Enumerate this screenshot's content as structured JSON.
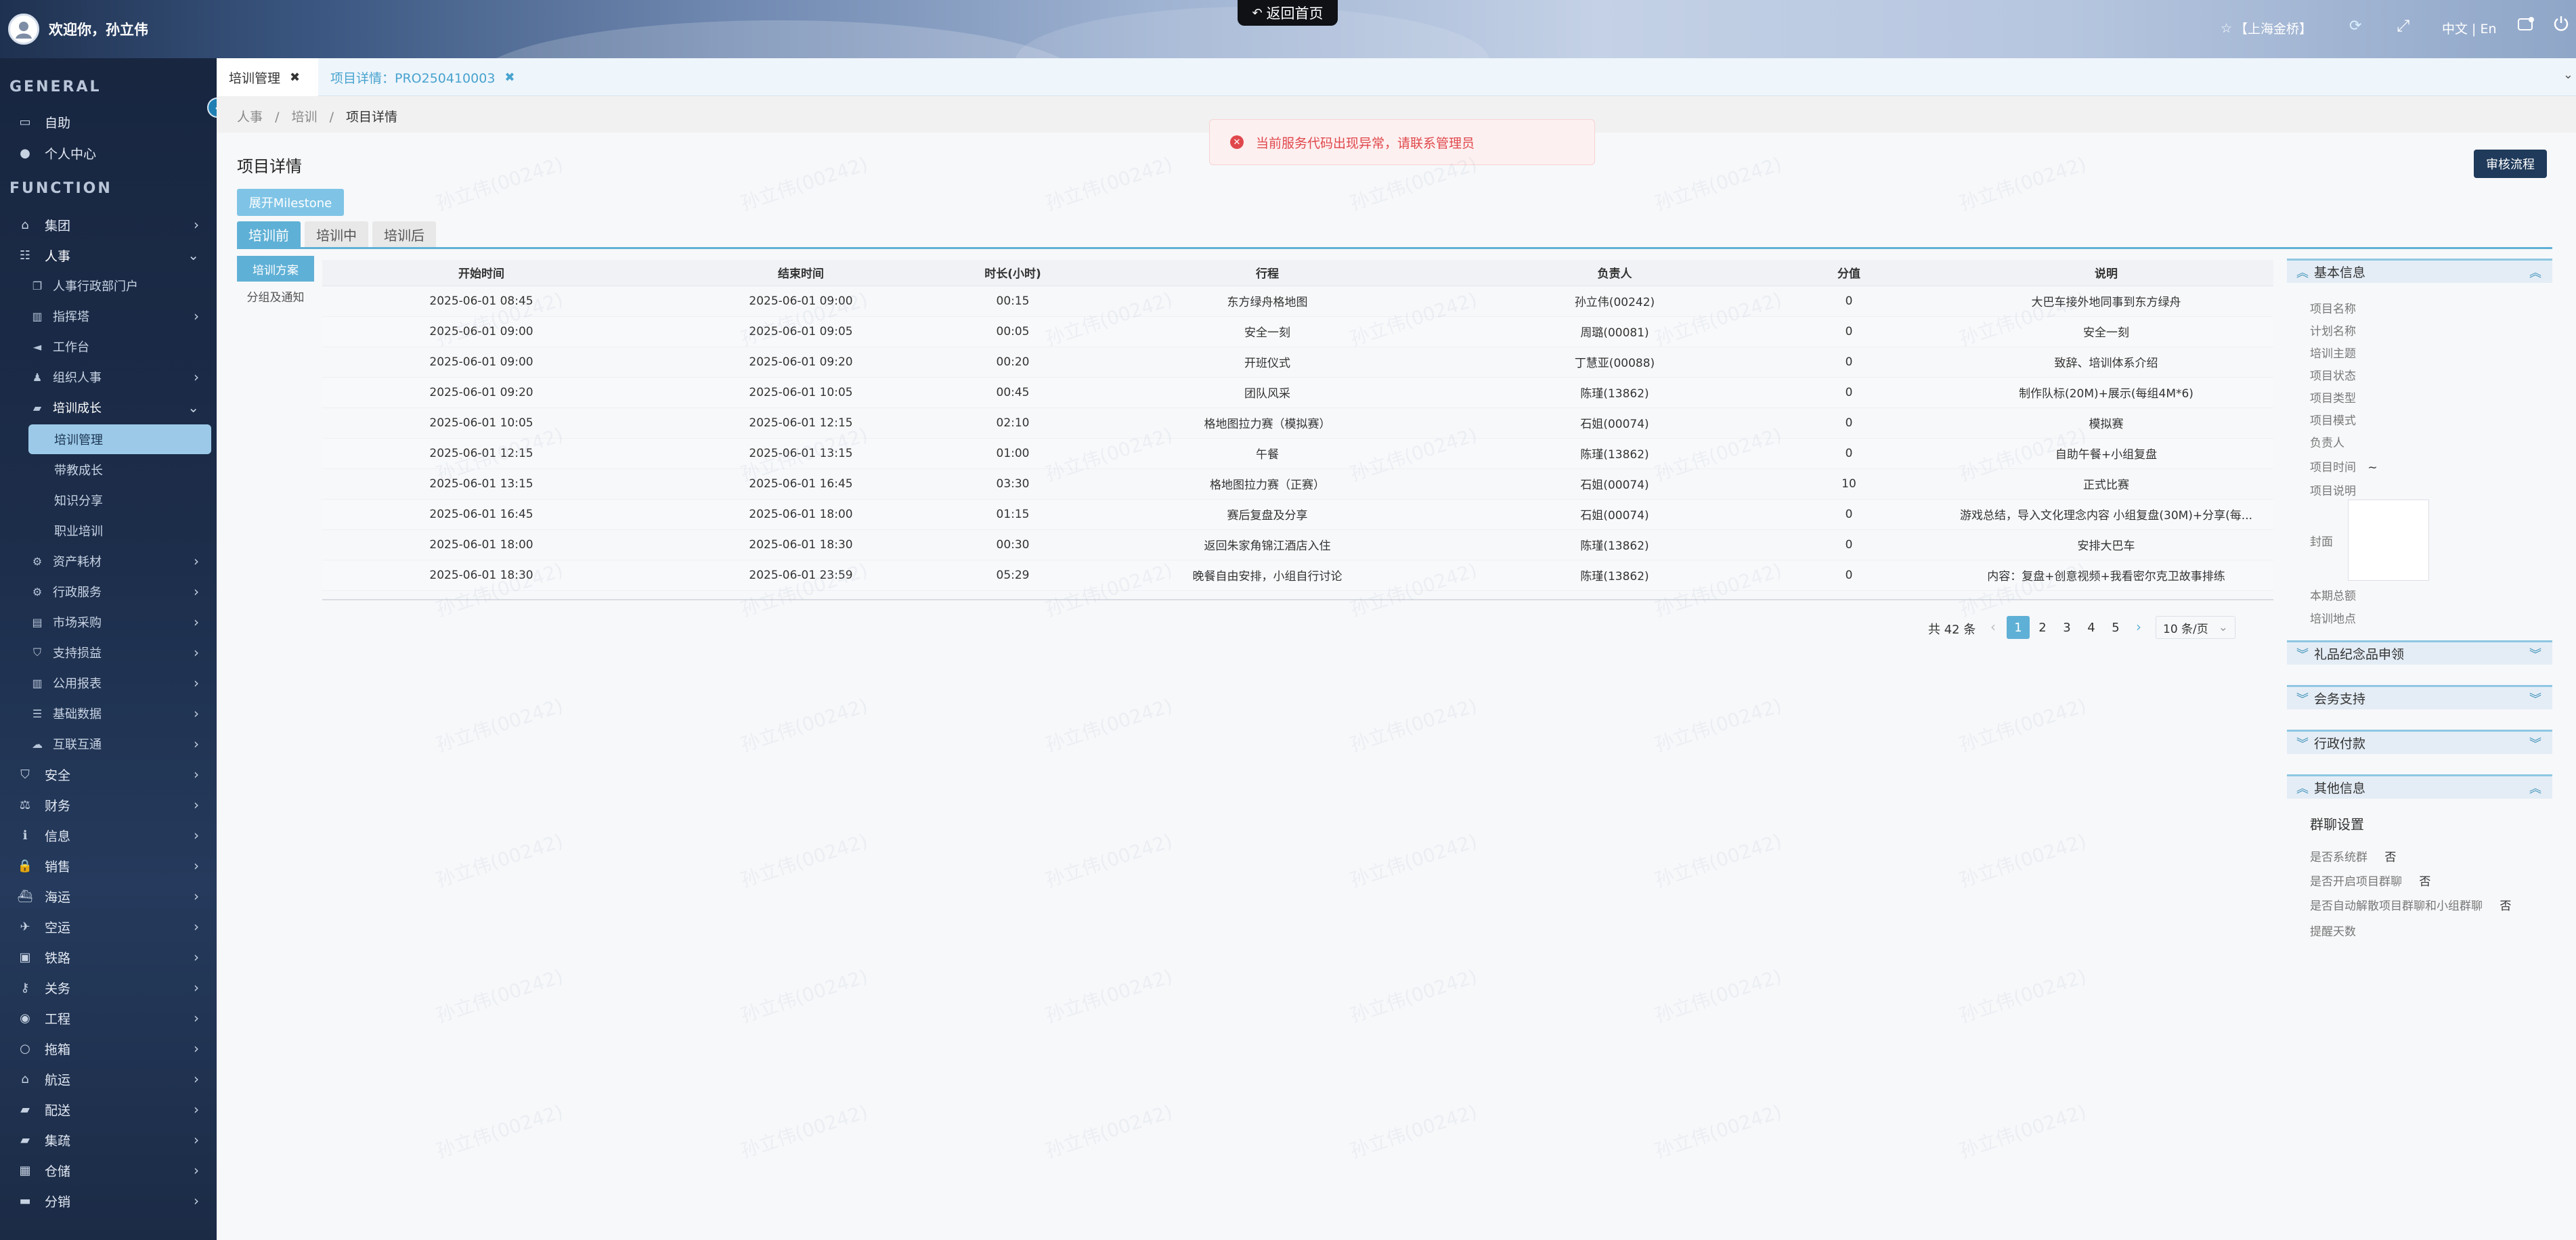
{
  "header": {
    "welcome": "欢迎你，孙立伟",
    "home_button": "返回首页",
    "location": "【上海金桥】",
    "language": "中文 | En"
  },
  "sidebar": {
    "general_label": "GENERAL",
    "function_label": "FUNCTION",
    "general_items": [
      {
        "label": "自助",
        "icon": "desktop-icon"
      },
      {
        "label": "个人中心",
        "icon": "user-icon"
      }
    ],
    "function_items": [
      {
        "label": "集团",
        "icon": "bank-icon"
      },
      {
        "label": "人事",
        "icon": "sitemap-icon"
      }
    ],
    "hr_items": [
      {
        "label": "人事行政部门户",
        "icon": "copy-icon",
        "chevron": false
      },
      {
        "label": "指挥塔",
        "icon": "bar-chart-icon",
        "chevron": true
      },
      {
        "label": "工作台",
        "icon": "bullhorn-icon",
        "chevron": false
      },
      {
        "label": "组织人事",
        "icon": "users-icon",
        "chevron": true
      },
      {
        "label": "培训成长",
        "icon": "book-icon",
        "chevron": true
      }
    ],
    "training_items": [
      "培训管理",
      "带教成长",
      "知识分享",
      "职业培训"
    ],
    "hr_more_items": [
      {
        "label": "资产耗材",
        "icon": "gear-icon"
      },
      {
        "label": "行政服务",
        "icon": "gear-icon"
      },
      {
        "label": "市场采购",
        "icon": "cart-icon"
      },
      {
        "label": "支持损益",
        "icon": "shield-icon"
      },
      {
        "label": "公用报表",
        "icon": "chart-icon"
      },
      {
        "label": "基础数据",
        "icon": "database-icon"
      },
      {
        "label": "互联互通",
        "icon": "cloud-icon"
      }
    ],
    "bottom_items": [
      {
        "label": "安全",
        "icon": "shield-icon"
      },
      {
        "label": "财务",
        "icon": "balance-icon"
      },
      {
        "label": "信息",
        "icon": "info-icon"
      },
      {
        "label": "销售",
        "icon": "lock-icon"
      },
      {
        "label": "海运",
        "icon": "ship-icon"
      },
      {
        "label": "空运",
        "icon": "plane-icon"
      },
      {
        "label": "铁路",
        "icon": "train-icon"
      },
      {
        "label": "关务",
        "icon": "key-icon"
      },
      {
        "label": "工程",
        "icon": "globe-icon"
      },
      {
        "label": "拖箱",
        "icon": "circle-icon"
      },
      {
        "label": "航运",
        "icon": "bank-icon"
      },
      {
        "label": "配送",
        "icon": "truck-icon"
      },
      {
        "label": "集疏",
        "icon": "truck-icon"
      },
      {
        "label": "仓储",
        "icon": "building-icon"
      },
      {
        "label": "分销",
        "icon": "card-icon"
      }
    ]
  },
  "tabs": [
    {
      "label": "培训管理",
      "active": true
    },
    {
      "label": "项目详情：PRO250410003",
      "active": false
    }
  ],
  "breadcrumb": [
    "人事",
    "培训",
    "项目详情"
  ],
  "page": {
    "title": "项目详情",
    "review_button": "审核流程",
    "milestone_button": "展开Milestone",
    "phase_tabs": [
      "培训前",
      "培训中",
      "培训后"
    ],
    "left_menu": [
      "培训方案",
      "分组及通知"
    ]
  },
  "error_toast": "当前服务代码出现异常，请联系管理员",
  "table": {
    "columns": [
      "开始时间",
      "结束时间",
      "时长(小时)",
      "行程",
      "负责人",
      "分值",
      "说明"
    ],
    "rows": [
      [
        "2025-06-01 08:45",
        "2025-06-01 09:00",
        "00:15",
        "东方绿舟格地图",
        "孙立伟(00242)",
        "0",
        "大巴车接外地同事到东方绿舟"
      ],
      [
        "2025-06-01 09:00",
        "2025-06-01 09:05",
        "00:05",
        "安全一刻",
        "周璐(00081)",
        "0",
        "安全一刻"
      ],
      [
        "2025-06-01 09:00",
        "2025-06-01 09:20",
        "00:20",
        "开班仪式",
        "丁慧亚(00088)",
        "0",
        "致辞、培训体系介绍"
      ],
      [
        "2025-06-01 09:20",
        "2025-06-01 10:05",
        "00:45",
        "团队风采",
        "陈瑾(13862)",
        "0",
        "制作队标(20M)+展示(每组4M*6)"
      ],
      [
        "2025-06-01 10:05",
        "2025-06-01 12:15",
        "02:10",
        "格地图拉力赛（模拟赛）",
        "石姐(00074)",
        "0",
        "模拟赛"
      ],
      [
        "2025-06-01 12:15",
        "2025-06-01 13:15",
        "01:00",
        "午餐",
        "陈瑾(13862)",
        "0",
        "自助午餐+小组复盘"
      ],
      [
        "2025-06-01 13:15",
        "2025-06-01 16:45",
        "03:30",
        "格地图拉力赛（正赛）",
        "石姐(00074)",
        "10",
        "正式比赛"
      ],
      [
        "2025-06-01 16:45",
        "2025-06-01 18:00",
        "01:15",
        "赛后复盘及分享",
        "石姐(00074)",
        "0",
        "游戏总结，导入文化理念内容 小组复盘(30M)+分享(每..."
      ],
      [
        "2025-06-01 18:00",
        "2025-06-01 18:30",
        "00:30",
        "返回朱家角锦江酒店入住",
        "陈瑾(13862)",
        "0",
        "安排大巴车"
      ],
      [
        "2025-06-01 18:30",
        "2025-06-01 23:59",
        "05:29",
        "晚餐自由安排，小组自行讨论",
        "陈瑾(13862)",
        "0",
        "内容：复盘+创意视频+我看密尔克卫故事排练"
      ]
    ]
  },
  "pagination": {
    "total": "共 42 条",
    "pages": [
      "1",
      "2",
      "3",
      "4",
      "5"
    ],
    "current": "1",
    "page_size": "10 条/页"
  },
  "right_panel": {
    "basic_info": {
      "title": "基本信息",
      "fields": [
        "项目名称",
        "计划名称",
        "培训主题",
        "项目状态",
        "项目类型",
        "项目模式",
        "负责人"
      ],
      "time_label": "项目时间",
      "time_value": "~",
      "desc_label": "项目说明",
      "cover_label": "封面",
      "budget_label": "本期总额",
      "location_label": "培训地点"
    },
    "sections": [
      "礼品纪念品申领",
      "会务支持",
      "行政付款"
    ],
    "other": {
      "title": "其他信息",
      "group_title": "群聊设置",
      "items": [
        {
          "label": "是否系统群",
          "value": "否"
        },
        {
          "label": "是否开启项目群聊",
          "value": "否"
        },
        {
          "label": "是否自动解散项目群聊和小组群聊",
          "value": "否"
        }
      ],
      "remind_label": "提醒天数"
    }
  },
  "watermark": "孙立伟(00242)",
  "colors": {
    "accent": "#5fb0d6",
    "primary_dark": "#1f3a5a",
    "error": "#e0474c",
    "sidebar": "#1c2d4a",
    "active_menu": "#9cc9e8"
  }
}
